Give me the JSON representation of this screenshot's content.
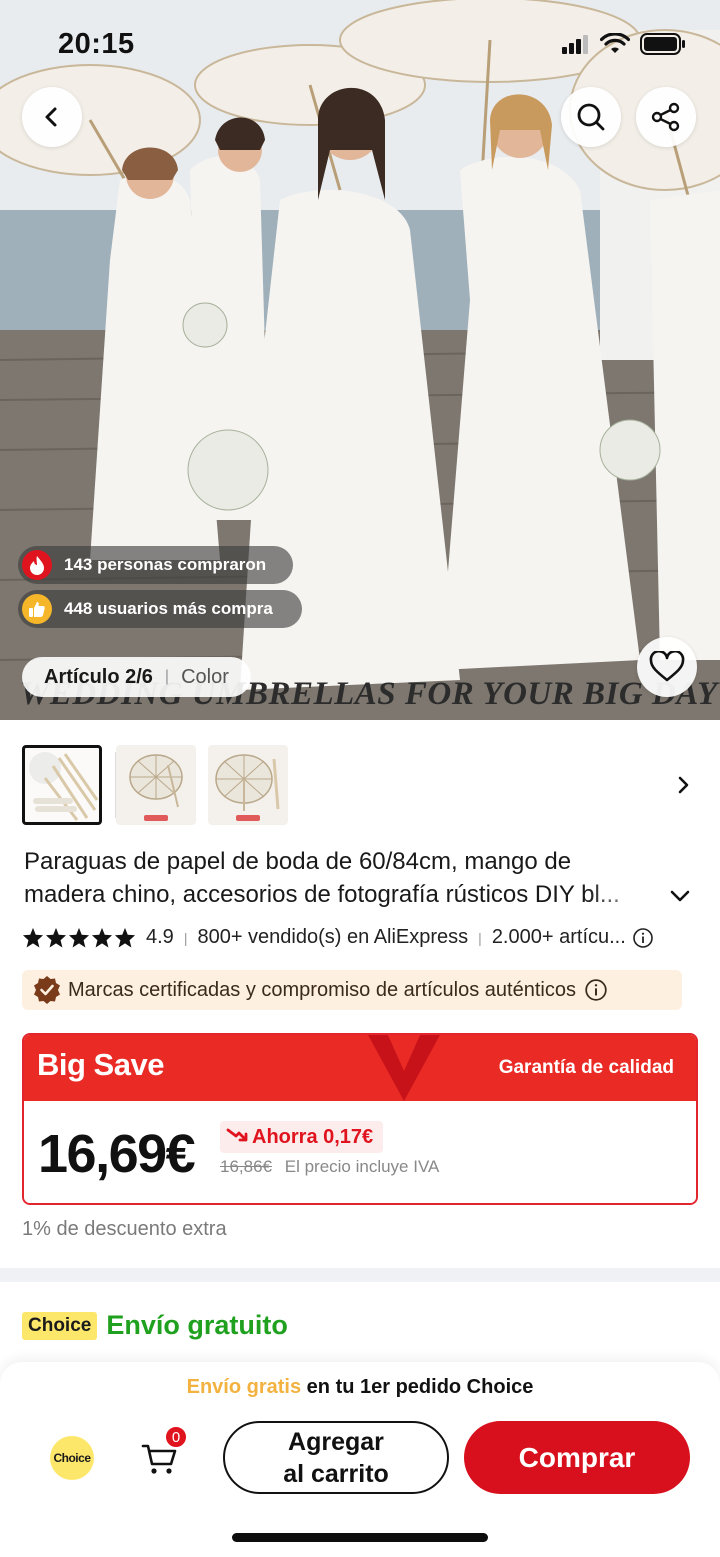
{
  "status_bar": {
    "time": "20:15"
  },
  "hero": {
    "social_proof": [
      {
        "text": "143 personas compraron",
        "icon": "flame-icon",
        "color": "#e0141e"
      },
      {
        "text": "448 usuarios más compra",
        "icon": "thumbs-up-icon",
        "color": "#f5b62a"
      }
    ],
    "article_label": "Artículo 2/6",
    "color_label": "Color",
    "banner_text": "WEDDING UMBRELLAS FOR YOUR BIG DAY"
  },
  "product": {
    "title_line1": "Paraguas de papel de boda de 60/84cm, mango de",
    "title_line2": "madera chino, accesorios de fotografía rústicos DIY bl...",
    "rating": "4.9",
    "sold": "800+ vendido(s) en AliExpress",
    "items": "2.000+ artícu...",
    "stars": 5,
    "certified_text": "Marcas certificadas y compromiso de artículos auténticos"
  },
  "price": {
    "header_left": "Big Save",
    "header_right": "Garantía  de calidad",
    "current": "16,69€",
    "saving": "Ahorra 0,17€",
    "original": "16,86€",
    "vat_note": "El precio incluye IVA",
    "extra_discount": "1% de descuento extra"
  },
  "shipping": {
    "choice_tag": "Choice",
    "free_shipping": "Envío gratuito"
  },
  "bottom_bar": {
    "promo_highlight": "Envío gratis",
    "promo_rest": " en tu 1er pedido Choice",
    "choice_badge": "Choice",
    "cart_count": "0",
    "add_to_cart": "Agregar\nal carrito",
    "buy": "Comprar"
  },
  "colors": {
    "accent_red": "#e0141e",
    "buy_red": "#d8101d",
    "choice_yellow": "#fde76a",
    "free_green": "#1fa11f"
  }
}
